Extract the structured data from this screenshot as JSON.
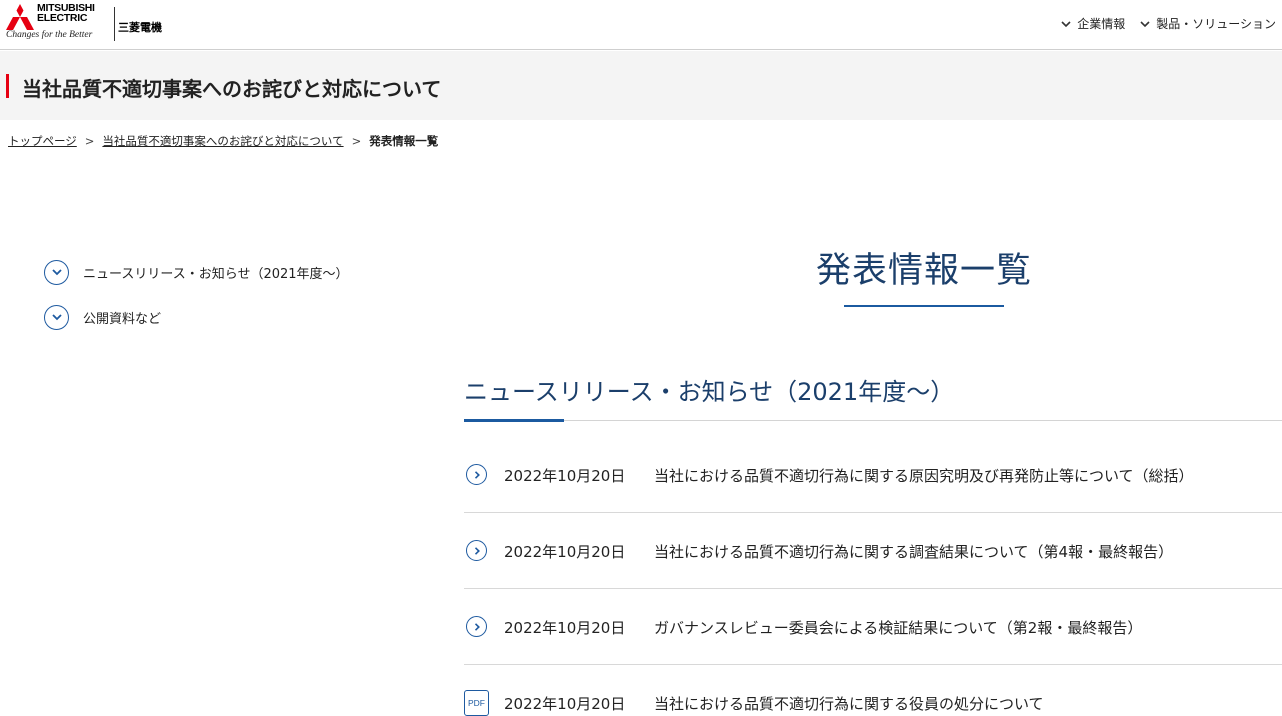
{
  "header": {
    "brand_line1": "MITSUBISHI",
    "brand_line2": "ELECTRIC",
    "tagline": "Changes for the Better",
    "brand_jp": "三菱電機",
    "nav": [
      {
        "label": "企業情報",
        "icon": "chevron-down-icon"
      },
      {
        "label": "製品・ソリューション",
        "icon": "chevron-down-icon"
      }
    ]
  },
  "page": {
    "title": "当社品質不適切事案へのお詫びと対応について"
  },
  "breadcrumb": {
    "items": [
      "トップページ",
      "当社品質不適切事案へのお詫びと対応について"
    ],
    "separator": ">",
    "current": "発表情報一覧"
  },
  "sidenav": {
    "items": [
      {
        "label": "ニュースリリース・お知らせ（2021年度〜）",
        "icon": "chevron-down-circle-icon"
      },
      {
        "label": "公開資料など",
        "icon": "chevron-down-circle-icon"
      }
    ]
  },
  "main": {
    "title": "発表情報一覧",
    "section_title": "ニュースリリース・お知らせ（2021年度〜）",
    "news": [
      {
        "icon": "arrow-right-circle-icon",
        "date": "2022年10月20日",
        "text": "当社における品質不適切行為に関する原因究明及び再発防止等について（総括）"
      },
      {
        "icon": "arrow-right-circle-icon",
        "date": "2022年10月20日",
        "text": "当社における品質不適切行為に関する調査結果について（第4報・最終報告）"
      },
      {
        "icon": "arrow-right-circle-icon",
        "date": "2022年10月20日",
        "text": "ガバナンスレビュー委員会による検証結果について（第2報・最終報告）"
      },
      {
        "icon": "pdf-icon",
        "icon_label": "PDF",
        "date": "2022年10月20日",
        "text": "当社における品質不適切行為に関する役員の処分について"
      }
    ]
  },
  "colors": {
    "accent_red": "#e60012",
    "link_blue": "#1e5aa0",
    "heading_navy": "#1b3f6b"
  }
}
